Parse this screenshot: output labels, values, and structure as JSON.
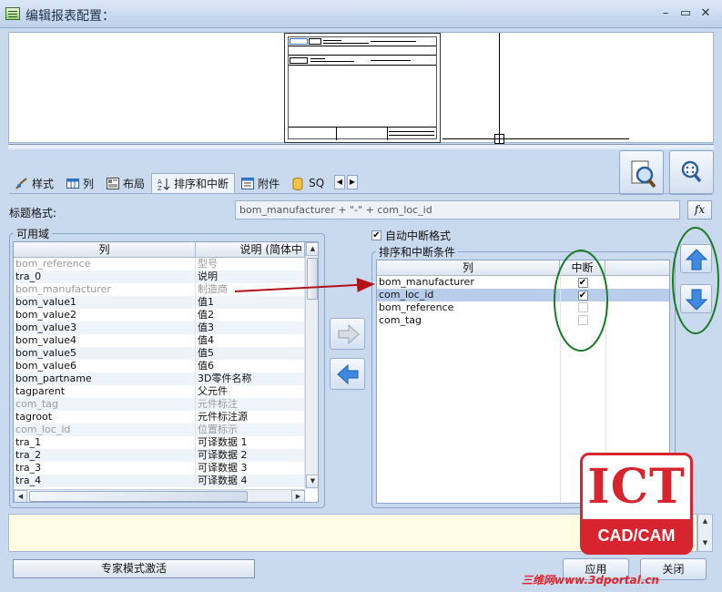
{
  "window": {
    "title": "编辑报表配置：",
    "min_glyph": "–",
    "max_glyph": "▭",
    "close_glyph": "✕"
  },
  "tabs": [
    {
      "label": "样式",
      "icon": "style-icon"
    },
    {
      "label": "列",
      "icon": "columns-icon"
    },
    {
      "label": "布局",
      "icon": "layout-icon"
    },
    {
      "label": "排序和中断",
      "icon": "sort-icon",
      "active": true
    },
    {
      "label": "附件",
      "icon": "attachment-icon"
    },
    {
      "label": "SQ",
      "icon": "database-icon"
    }
  ],
  "header_format": {
    "label": "标题格式:",
    "value": "bom_manufacturer + \"-\" + com_loc_id",
    "fx_label": "fx"
  },
  "available": {
    "title": "可用域",
    "columns": [
      "列",
      "说明 (简体中"
    ],
    "rows": [
      {
        "col": "bom_reference",
        "desc": "型号",
        "dim": true
      },
      {
        "col": "tra_0",
        "desc": "说明",
        "dim": false
      },
      {
        "col": "bom_manufacturer",
        "desc": "制造商",
        "dim": true
      },
      {
        "col": "bom_value1",
        "desc": "值1",
        "dim": false
      },
      {
        "col": "bom_value2",
        "desc": "值2",
        "dim": false
      },
      {
        "col": "bom_value3",
        "desc": "值3",
        "dim": false
      },
      {
        "col": "bom_value4",
        "desc": "值4",
        "dim": false
      },
      {
        "col": "bom_value5",
        "desc": "值5",
        "dim": false
      },
      {
        "col": "bom_value6",
        "desc": "值6",
        "dim": false
      },
      {
        "col": "bom_partname",
        "desc": "3D零件名称",
        "dim": false
      },
      {
        "col": "tagparent",
        "desc": "父元件",
        "dim": false
      },
      {
        "col": "com_tag",
        "desc": "元件标注",
        "dim": true
      },
      {
        "col": "tagroot",
        "desc": "元件标注源",
        "dim": false
      },
      {
        "col": "com_loc_id",
        "desc": "位置标示",
        "dim": true
      },
      {
        "col": "tra_1",
        "desc": "可译数据 1",
        "dim": false
      },
      {
        "col": "tra_2",
        "desc": "可译数据 2",
        "dim": false
      },
      {
        "col": "tra_3",
        "desc": "可译数据 3",
        "dim": false
      },
      {
        "col": "tra_4",
        "desc": "可译数据 4",
        "dim": false
      }
    ]
  },
  "auto_break": {
    "label": "自动中断格式",
    "checked": true
  },
  "sort_break": {
    "title": "排序和中断条件",
    "columns": [
      "列",
      "中断"
    ],
    "rows": [
      {
        "col": "bom_manufacturer",
        "break": true,
        "selected": false,
        "enabled": true
      },
      {
        "col": "com_loc_id",
        "break": true,
        "selected": true,
        "enabled": true
      },
      {
        "col": "bom_reference",
        "break": false,
        "selected": false,
        "enabled": false
      },
      {
        "col": "com_tag",
        "break": false,
        "selected": false,
        "enabled": false
      }
    ]
  },
  "footer": {
    "expert_mode": "专家模式激活",
    "apply": "应用",
    "close": "关闭"
  },
  "watermark": {
    "ict": "ICT",
    "cadcam": "CAD/CAM",
    "url": "三维网www.3dportal.cn"
  },
  "colors": {
    "accent_blue": "#2f74c8",
    "annotation_green": "#1c7a2a",
    "annotation_red": "#b3121b",
    "watermark_red": "#d8242f"
  }
}
